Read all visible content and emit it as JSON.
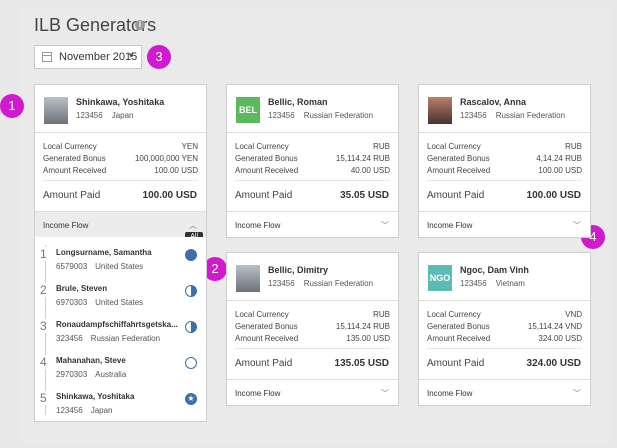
{
  "header": {
    "title": "ILB Generators",
    "info_icon": "info-icon"
  },
  "date_filter": {
    "value": "November 2015",
    "icon": "calendar-icon"
  },
  "badges": [
    "1",
    "2",
    "3",
    "4"
  ],
  "cards": [
    {
      "name": "Shinkawa, Yoshitaka",
      "id": "123456",
      "country": "Japan",
      "local_currency_label": "Local Currency",
      "local_currency": "YEN",
      "bonus_label": "Generated Bonus",
      "bonus": "100,000,000 YEN",
      "received_label": "Amount Received",
      "received": "100.00 USD",
      "paid_label": "Amount Paid",
      "paid": "100.00 USD",
      "flow_label": "Income Flow"
    },
    {
      "name": "Bellic, Roman",
      "id": "123456",
      "country": "Russian Federation",
      "logo": "BEL",
      "local_currency_label": "Local Currency",
      "local_currency": "RUB",
      "bonus_label": "Generated Bonus",
      "bonus": "15,114.24 RUB",
      "received_label": "Amount Received",
      "received": "40.00 USD",
      "paid_label": "Amount Paid",
      "paid": "35.05 USD",
      "flow_label": "Income Flow"
    },
    {
      "name": "Rascalov, Anna",
      "id": "123456",
      "country": "Russian Federation",
      "local_currency_label": "Local Currency",
      "local_currency": "RUB",
      "bonus_label": "Generated Bonus",
      "bonus": "4,14.24 RUB",
      "received_label": "Amount Received",
      "received": "100.00 USD",
      "paid_label": "Amount Paid",
      "paid": "100.00 USD",
      "flow_label": "Income Flow"
    },
    {
      "name": "Bellic, Dimitry",
      "id": "123456",
      "country": "Russian Federation",
      "local_currency_label": "Local Currency",
      "local_currency": "RUB",
      "bonus_label": "Generated Bonus",
      "bonus": "15,114.24 RUB",
      "received_label": "Amount Received",
      "received": "135.00 USD",
      "paid_label": "Amount Paid",
      "paid": "135.05 USD",
      "flow_label": "Income Flow"
    },
    {
      "name": "Ngoc, Dam Vinh",
      "id": "123456",
      "country": "Vietnam",
      "logo": "NGO",
      "local_currency_label": "Local Currency",
      "local_currency": "VND",
      "bonus_label": "Generated Bonus",
      "bonus": "15,114.24 VND",
      "received_label": "Amount Received",
      "received": "324.00 USD",
      "paid_label": "Amount Paid",
      "paid": "324.00 USD",
      "flow_label": "Income Flow"
    }
  ],
  "income_flow": {
    "tooltip": "All",
    "items": [
      {
        "num": "1",
        "name": "Longsurname, Samantha",
        "id": "6579003",
        "country": "United States",
        "status": "full"
      },
      {
        "num": "2",
        "name": "Brule, Steven",
        "id": "6970303",
        "country": "United States",
        "status": "half"
      },
      {
        "num": "3",
        "name": "Ronaudampfschiffahrtsgetska...",
        "id": "323456",
        "country": "Russian Federation",
        "status": "half"
      },
      {
        "num": "4",
        "name": "Mahanahan, Steve",
        "id": "2970303",
        "country": "Australia",
        "status": "empty"
      },
      {
        "num": "5",
        "name": "Shinkawa, Yoshitaka",
        "id": "123456",
        "country": "Japan",
        "status": "star"
      }
    ]
  },
  "colors": {
    "badge": "#d11acd",
    "bel_logo": "#5cb85c",
    "ngo_logo": "#5bbcb4",
    "status": "#3d6fa8"
  }
}
